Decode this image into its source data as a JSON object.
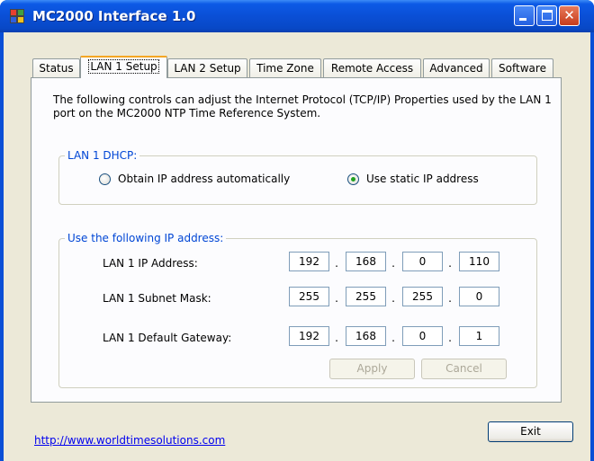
{
  "window": {
    "title": "MC2000 Interface 1.0"
  },
  "tabs": [
    {
      "label": "Status"
    },
    {
      "label": "LAN 1 Setup"
    },
    {
      "label": "LAN 2 Setup"
    },
    {
      "label": "Time Zone"
    },
    {
      "label": "Remote Access"
    },
    {
      "label": "Advanced"
    },
    {
      "label": "Software"
    }
  ],
  "active_tab": "LAN 1 Setup",
  "description": "The following controls can adjust the Internet Protocol (TCP/IP) Properties used by the LAN 1 port on the MC2000 NTP Time Reference System.",
  "dhcp_group": {
    "legend": "LAN 1 DHCP:",
    "options": [
      {
        "label": "Obtain IP address automatically",
        "checked": false
      },
      {
        "label": "Use static IP address",
        "checked": true
      }
    ]
  },
  "ip_group": {
    "legend": "Use the following IP address:",
    "rows": [
      {
        "label": "LAN 1 IP Address:",
        "octets": [
          "192",
          "168",
          "0",
          "110"
        ]
      },
      {
        "label": "LAN 1 Subnet Mask:",
        "octets": [
          "255",
          "255",
          "255",
          "0"
        ]
      },
      {
        "label": "LAN 1 Default Gateway:",
        "octets": [
          "192",
          "168",
          "0",
          "1"
        ]
      }
    ],
    "separator": ".",
    "apply_label": "Apply",
    "cancel_label": "Cancel"
  },
  "footer": {
    "link_text": "http://www.worldtimesolutions.com",
    "exit_label": "Exit"
  },
  "colors": {
    "titlebar": "#0a4fd6",
    "client_bg": "#ece9d8",
    "group_legend": "#0046d5",
    "link": "#0000ee",
    "active_tab_accent": "#f5a623"
  },
  "icons": [
    "app-icon",
    "minimize-icon",
    "maximize-icon",
    "close-icon"
  ]
}
